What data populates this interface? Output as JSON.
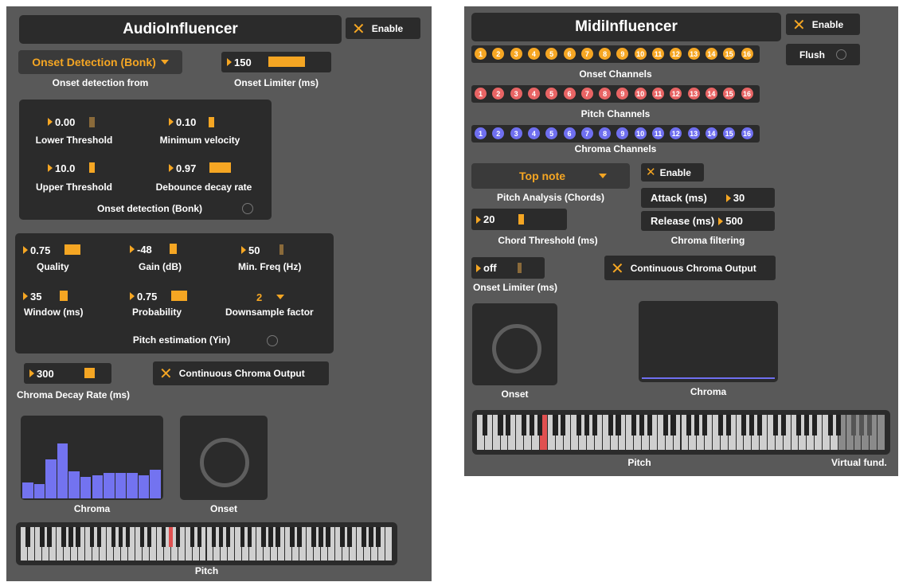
{
  "audio": {
    "title": "AudioInfluencer",
    "enable_label": "Enable",
    "onset_menu": "Onset Detection (Bonk)",
    "onset_from_label": "Onset detection from",
    "onset_limiter_value": "150",
    "onset_limiter_label": "Onset Limiter (ms)",
    "bonk": {
      "lower_threshold_value": "0.00",
      "lower_threshold_label": "Lower Threshold",
      "min_velocity_value": "0.10",
      "min_velocity_label": "Minimum velocity",
      "upper_threshold_value": "10.0",
      "upper_threshold_label": "Upper Threshold",
      "debounce_value": "0.97",
      "debounce_label": "Debounce decay rate",
      "section_label": "Onset detection (Bonk)"
    },
    "yin": {
      "quality_value": "0.75",
      "quality_label": "Quality",
      "gain_value": "-48",
      "gain_label": "Gain (dB)",
      "minfreq_value": "50",
      "minfreq_label": "Min. Freq (Hz)",
      "window_value": "35",
      "window_label": "Window (ms)",
      "probability_value": "0.75",
      "probability_label": "Probability",
      "downsample_value": "2",
      "downsample_label": "Downsample factor",
      "section_label": "Pitch estimation (Yin)"
    },
    "chroma_decay_value": "300",
    "chroma_decay_label": "Chroma Decay Rate (ms)",
    "continuous_label": "Continuous Chroma Output",
    "chroma_label": "Chroma",
    "onset_label": "Onset",
    "pitch_label": "Pitch",
    "chroma_values": [
      0.2,
      0.18,
      0.5,
      0.7,
      0.35,
      0.28,
      0.3,
      0.33,
      0.33,
      0.33,
      0.3,
      0.37
    ]
  },
  "midi": {
    "title": "MidiInfluencer",
    "enable_label": "Enable",
    "flush_label": "Flush",
    "onset_channels_label": "Onset Channels",
    "pitch_channels_label": "Pitch Channels",
    "chroma_channels_label": "Chroma Channels",
    "channels": [
      "1",
      "2",
      "3",
      "4",
      "5",
      "6",
      "7",
      "8",
      "9",
      "10",
      "11",
      "12",
      "13",
      "14",
      "15",
      "16"
    ],
    "pitch_analysis_menu": "Top note",
    "pitch_analysis_label": "Pitch Analysis (Chords)",
    "filter_enable_label": "Enable",
    "attack_label": "Attack (ms)",
    "attack_value": "30",
    "release_label": "Release (ms)",
    "release_value": "500",
    "chroma_filtering_label": "Chroma filtering",
    "chord_threshold_value": "20",
    "chord_threshold_label": "Chord Threshold (ms)",
    "onset_limiter_value": "off",
    "onset_limiter_label": "Onset Limiter (ms)",
    "continuous_label": "Continuous Chroma Output",
    "onset_label": "Onset",
    "chroma_label": "Chroma",
    "pitch_label": "Pitch",
    "virtual_fund_label": "Virtual fund."
  },
  "colors": {
    "accent": "#f5a623",
    "onset_dot": "#f5a623",
    "pitch_dot": "#e86464",
    "chroma_dot": "#6f6ff0",
    "chroma_bar": "#7373f0",
    "key_highlight": "#e05050"
  }
}
